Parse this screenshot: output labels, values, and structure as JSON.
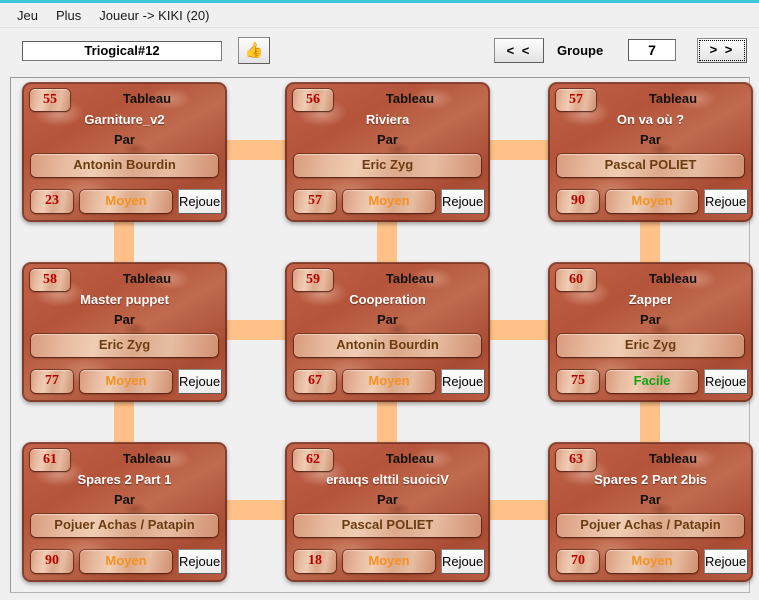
{
  "menu": {
    "items": [
      {
        "label": "Jeu"
      },
      {
        "label": "Plus"
      },
      {
        "label": "Joueur -> KIKI (20)"
      }
    ]
  },
  "toolbar": {
    "level_name": "Triogical#12",
    "level_name_placeholder": "Triogical#12",
    "validate_icon": "thumbs-up-icon",
    "validate_glyph": "👍",
    "prev_label": "< <",
    "groupe_label": "Groupe",
    "groupe_value": "7",
    "next_label": "> >"
  },
  "colors": {
    "accent_connector": "#ffc187",
    "card_brick": "#b9563c",
    "score_red": "#b40000",
    "difficulty_moyen": "#f59120",
    "difficulty_facile": "#13a313",
    "author_brown": "#6b3d12",
    "top_border_cyan": "#3fc8d8"
  },
  "board": {
    "labels": {
      "tableau": "Tableau",
      "par": "Par",
      "replay": "Rejouer"
    },
    "cards": [
      {
        "number": "55",
        "tableau": "Tableau",
        "title": "Garniture_v2",
        "par": "Par",
        "author": "Antonin Bourdin",
        "score": "23",
        "difficulty": "Moyen",
        "difficulty_class": "diff-moyen",
        "replay": "Rejouer"
      },
      {
        "number": "56",
        "tableau": "Tableau",
        "title": "Riviera",
        "par": "Par",
        "author": "Eric Zyg",
        "score": "57",
        "difficulty": "Moyen",
        "difficulty_class": "diff-moyen",
        "replay": "Rejouer"
      },
      {
        "number": "57",
        "tableau": "Tableau",
        "title": "On va où ?",
        "par": "Par",
        "author": "Pascal POLIET",
        "score": "90",
        "difficulty": "Moyen",
        "difficulty_class": "diff-moyen",
        "replay": "Rejouer"
      },
      {
        "number": "58",
        "tableau": "Tableau",
        "title": "Master puppet",
        "par": "Par",
        "author": "Eric Zyg",
        "score": "77",
        "difficulty": "Moyen",
        "difficulty_class": "diff-moyen",
        "replay": "Rejouer"
      },
      {
        "number": "59",
        "tableau": "Tableau",
        "title": "Cooperation",
        "par": "Par",
        "author": "Antonin Bourdin",
        "score": "67",
        "difficulty": "Moyen",
        "difficulty_class": "diff-moyen",
        "replay": "Rejouer"
      },
      {
        "number": "60",
        "tableau": "Tableau",
        "title": "Zapper",
        "par": "Par",
        "author": "Eric Zyg",
        "score": "75",
        "difficulty": "Facile",
        "difficulty_class": "diff-facile",
        "replay": "Rejouer"
      },
      {
        "number": "61",
        "tableau": "Tableau",
        "title": "Spares 2 Part 1",
        "par": "Par",
        "author": "Pojuer Achas / Patapin",
        "score": "90",
        "difficulty": "Moyen",
        "difficulty_class": "diff-moyen",
        "replay": "Rejouer"
      },
      {
        "number": "62",
        "tableau": "Tableau",
        "title": "erauqs elttil suoiciV",
        "par": "Par",
        "author": "Pascal POLIET",
        "score": "18",
        "difficulty": "Moyen",
        "difficulty_class": "diff-moyen",
        "replay": "Rejouer"
      },
      {
        "number": "63",
        "tableau": "Tableau",
        "title": "Spares 2 Part 2bis",
        "par": "Par",
        "author": "Pojuer Achas / Patapin",
        "score": "70",
        "difficulty": "Moyen",
        "difficulty_class": "diff-moyen",
        "replay": "Rejouer"
      }
    ]
  }
}
